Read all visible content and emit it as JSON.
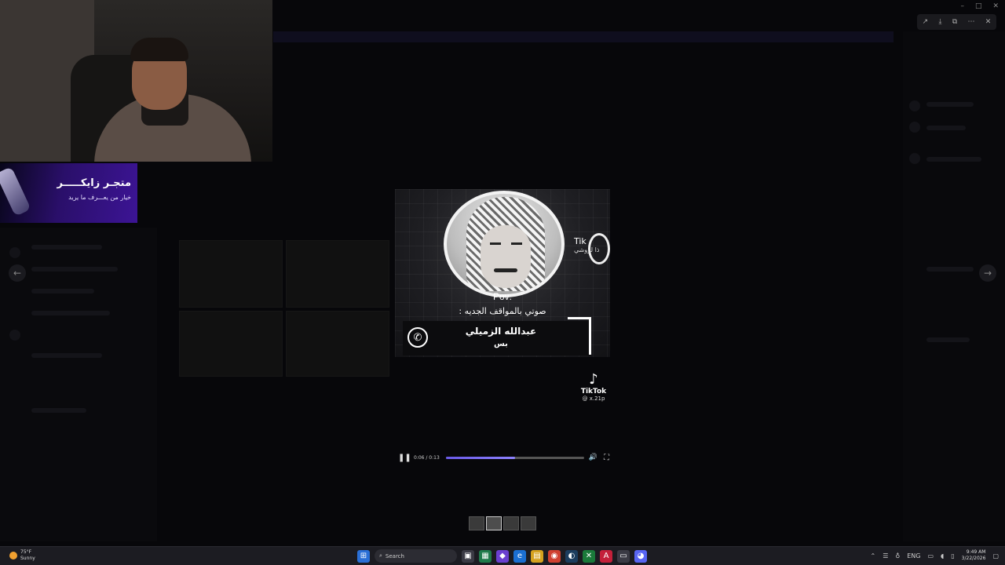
{
  "banner": {
    "title": "متجـر زايكـــــر",
    "subtitle": "خيار من يعـــرف ما يريد"
  },
  "video": {
    "tiktok_inline_label": "Tik",
    "tiktok_inline_handle": "ذا لزوشي",
    "pov": "Pov:",
    "pov_caption": "صوتي بالمواقف الجديه :",
    "caller_name": "عبدالله الزميلي",
    "caller_sub": "بس",
    "watermark_name": "TikTok",
    "watermark_handle": "@ x.21p"
  },
  "player": {
    "time": "0:06 / 0:13",
    "progress": 0.5
  },
  "taskbar": {
    "weather_temp": "75°F",
    "weather_desc": "Sunny",
    "search_label": "Search",
    "lang": "ENG",
    "time": "9:49 AM",
    "date": "3/22/2026"
  },
  "icons": {
    "pause": "pause-icon",
    "volume": "volume-icon",
    "fullscreen": "fullscreen-icon",
    "phone": "phone-icon"
  },
  "colors": {
    "accent": "#7b6df2",
    "banner": "#3c1495"
  }
}
